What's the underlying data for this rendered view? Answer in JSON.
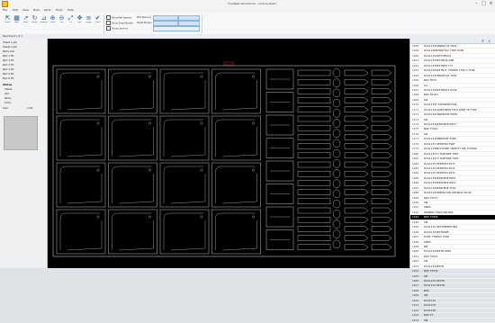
{
  "window": {
    "title": "FreeNest Workbench - [Active Nest]",
    "controls": [
      "–",
      "□",
      "×"
    ]
  },
  "menu": [
    "File",
    "Edit",
    "View",
    "Nest",
    "Parts",
    "Tools",
    "Help"
  ],
  "ribbon": {
    "tools": [
      {
        "icon": "pointer-icon",
        "glyph": "⇱",
        "label": "Select"
      },
      {
        "icon": "nest-icon",
        "glyph": "▦",
        "label": "Nest"
      },
      {
        "icon": "arrow-icon",
        "glyph": "↗",
        "label": "Move"
      },
      {
        "icon": "rotate-icon",
        "glyph": "↻",
        "label": "Rotate"
      },
      {
        "icon": "measure-icon",
        "glyph": "⊿",
        "label": "Measure"
      },
      {
        "icon": "zoom-in-icon",
        "glyph": "⊕",
        "label": "Zoom"
      },
      {
        "icon": "zoom-out-icon",
        "glyph": "⊖",
        "label": "Out"
      },
      {
        "icon": "zoom-fit-icon",
        "glyph": "⤢",
        "label": "Fit"
      },
      {
        "icon": "pan-icon",
        "glyph": "✥",
        "label": "Pan"
      },
      {
        "icon": "layers-icon",
        "glyph": "≡",
        "label": "Layers"
      },
      {
        "icon": "check-icon",
        "glyph": "✔",
        "label": "Check"
      }
    ],
    "groups": [
      "Nesting",
      "View",
      "Options",
      "Parameters"
    ],
    "options": [
      "Show Part Names",
      "Show Sheet Border",
      "Show Lead-ins"
    ],
    "options_right": [
      "Part Spacing",
      "Sheet Margin"
    ]
  },
  "subbar": {
    "label": "Nest Sheet 1 of 3"
  },
  "left_panel": {
    "rows": [
      "Sheet 1 Job",
      "Sheet 2 Job",
      "Parts List",
      "Part 1 Fit",
      "Part 2 Fit",
      "Part 3 Fit",
      "Part 4 Fit",
      "Part 5 Fit",
      "Part 6 Fit"
    ],
    "settings_title": "Status",
    "settings": [
      "Sheet:",
      "Util:",
      "Parts:",
      "Time:"
    ],
    "size_label": "Size",
    "size_value": "1.00"
  },
  "right_panel": {
    "items": [
      {
        "num": "1158",
        "text": "DCS1134TRWPR7A2 TR02"
      },
      {
        "num": "1159",
        "text": "DCS1136MTRB7TA2 TTRH DLTB"
      },
      {
        "num": "1160",
        "text": "DCS11150SE3TMDCS"
      },
      {
        "num": "1161",
        "text": "DCS1133SE3TMDS ONE"
      },
      {
        "num": "1162",
        "text": "DCS1133SE3TNDS 17T"
      },
      {
        "num": "1163",
        "text": "DCS1158SE3TN71 TTRDE6 7TRS A TTR6"
      },
      {
        "num": "1164",
        "text": "DCS1134TRWPR7A2 TR02"
      },
      {
        "num": "1165",
        "text": "BOX TR7S"
      },
      {
        "num": "1166",
        "text": "Sm"
      },
      {
        "num": "1167",
        "text": "DCS1134SE3TMDS3 DCS6"
      },
      {
        "num": "1168",
        "text": "BOX TR103"
      },
      {
        "num": "1169",
        "text": "SM"
      },
      {
        "num": "1170",
        "text": "DCS1134T 52MTRDE33C8"
      },
      {
        "num": "1171",
        "text": "DCS1134TLMRT3MC8 TM D 6TR6 TR TT85"
      },
      {
        "num": "1172",
        "text": "DCS1134TRWPRTMT MSTR"
      },
      {
        "num": "1173",
        "text": "SM"
      },
      {
        "num": "1174",
        "text": "DCS1133SE3RT8DE MSTT"
      },
      {
        "num": "1175",
        "text": "BOX TY922"
      },
      {
        "num": "1176",
        "text": "SM"
      },
      {
        "num": "1177",
        "text": "DCS1134TR8PRTMT 6TR8"
      },
      {
        "num": "1178",
        "text": "DCS1133 SE3RTRD TSRT"
      },
      {
        "num": "1179",
        "text": "DCS1134MD7ATRBT TRAB 67 96L TC36R6"
      },
      {
        "num": "1180",
        "text": "DCS1135YV 3DRTR6E 78E3"
      },
      {
        "num": "1181",
        "text": "DCS1132YV 3DRTR6E 76R3"
      },
      {
        "num": "1182",
        "text": "DCS1135 SE3RTRD 6ST3"
      },
      {
        "num": "1183",
        "text": "DCS1134 SE3RTRD 6ST1"
      },
      {
        "num": "1184",
        "text": "DCS1133 SE3RTRD 6ST2"
      },
      {
        "num": "1185",
        "text": "DCS1134SE3RT8DE 6RST"
      },
      {
        "num": "1186",
        "text": "DCS1133SE3RT8DE 6RST"
      },
      {
        "num": "1187",
        "text": "DCS1134SE3RT8DE TCSP"
      },
      {
        "num": "1188",
        "text": "DCS1134TRWPR7ATR 6DT6R4A DCS6"
      },
      {
        "num": "1189",
        "text": "BOX TX517"
      },
      {
        "num": "1190",
        "text": "SM"
      },
      {
        "num": "1191",
        "text": "SM6S"
      },
      {
        "num": "1192",
        "text": "DR8M6S TSR07R4LP0R"
      },
      {
        "num": "1193",
        "text": "BOX TY835"
      },
      {
        "num": "1194",
        "text": "SM"
      },
      {
        "num": "1195",
        "text": "DCS1132 SE3TR8MDE 6R3"
      },
      {
        "num": "1196",
        "text": "DCS1133SE3TR8DE"
      },
      {
        "num": "1197",
        "text": "DCBT TTRRG3 4TR8"
      },
      {
        "num": "1198",
        "text": "SM6S"
      },
      {
        "num": "1199",
        "text": "BM"
      },
      {
        "num": "1200",
        "text": "DCS1134SE3TR 6TR8"
      },
      {
        "num": "1201",
        "text": "BOX TX917"
      },
      {
        "num": "1202",
        "text": "SM"
      },
      {
        "num": "1203",
        "text": "DCS1134SE3TR"
      },
      {
        "num": "1204",
        "text": "BOX TX535"
      },
      {
        "num": "1205",
        "text": "SM"
      },
      {
        "num": "1206",
        "text": "DCS1134 SE3TR"
      },
      {
        "num": "1207",
        "text": "DCS1133 SE3TR"
      },
      {
        "num": "1208",
        "text": "BOX"
      },
      {
        "num": "1209",
        "text": "SM"
      },
      {
        "num": "1210",
        "text": "DCS1134"
      },
      {
        "num": "1211",
        "text": "DCS1135"
      },
      {
        "num": "1212",
        "text": "DCS1136"
      },
      {
        "num": "1213",
        "text": "BOX TX"
      },
      {
        "num": "1214",
        "text": "SM"
      }
    ],
    "selected_index": 35
  },
  "canvas": {
    "background": "#000000",
    "line_color": "#bfbfbf",
    "marker_color": "#b02020"
  }
}
